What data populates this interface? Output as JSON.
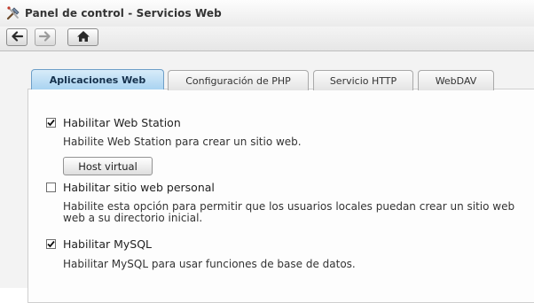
{
  "window": {
    "title": "Panel de control - Servicios Web",
    "icon": "tools-icon"
  },
  "toolbar": {
    "back": {
      "icon": "arrow-left-icon",
      "enabled": true
    },
    "forward": {
      "icon": "arrow-right-icon",
      "enabled": false
    },
    "home": {
      "icon": "home-icon",
      "enabled": true
    }
  },
  "tabs": [
    {
      "label": "Aplicaciones Web",
      "active": true
    },
    {
      "label": "Configuración de PHP",
      "active": false
    },
    {
      "label": "Servicio HTTP",
      "active": false
    },
    {
      "label": "WebDAV",
      "active": false
    }
  ],
  "settings": {
    "web_station": {
      "label": "Habilitar Web Station",
      "checked": true,
      "description": "Habilite Web Station para crear un sitio web.",
      "button": "Host virtual"
    },
    "personal_site": {
      "label": "Habilitar sitio web personal",
      "checked": false,
      "description_line1": "Habilite esta opción para permitir que los usuarios locales puedan crear un sitio web",
      "description_line2": "web a su directorio inicial."
    },
    "mysql": {
      "label": "Habilitar MySQL",
      "checked": true,
      "description": "Habilitar MySQL para usar funciones de base de datos."
    }
  },
  "colors": {
    "active_tab": "#a9d3f1",
    "background": "#f3f3f3",
    "panel": "#fdfdfd"
  }
}
